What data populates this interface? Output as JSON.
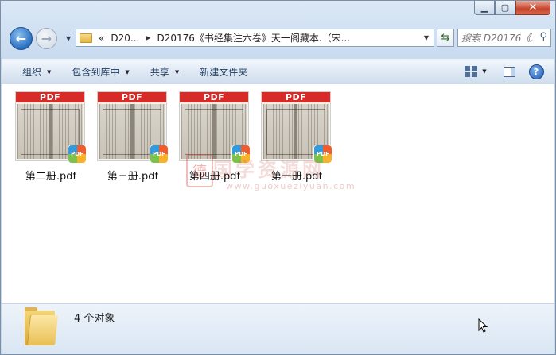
{
  "window": {
    "caption_buttons": [
      "minimize",
      "maximize",
      "close"
    ]
  },
  "navigation": {
    "back_icon": "back-arrow-icon",
    "forward_icon": "forward-arrow-icon",
    "breadcrumb": {
      "overflow": "«",
      "crumb1": "D20...",
      "crumb2": "D20176《书经集注六卷》天一阁藏本.（宋..."
    },
    "search_placeholder": "搜索 D20176《..."
  },
  "toolbar": {
    "organize": "组织",
    "include_in_library": "包含到库中",
    "share": "共享",
    "new_folder": "新建文件夹"
  },
  "files": [
    {
      "name": "第二册.pdf",
      "thumb_label": "PDF"
    },
    {
      "name": "第三册.pdf",
      "thumb_label": "PDF"
    },
    {
      "name": "第四册.pdf",
      "thumb_label": "PDF"
    },
    {
      "name": "第一册.pdf",
      "thumb_label": "PDF"
    }
  ],
  "watermark": {
    "seal": "德",
    "title": "国学资源网",
    "url": "www.guoxueziyuan.com"
  },
  "status": {
    "count_text": "4 个对象"
  },
  "colors": {
    "pdf_band": "#d62b26",
    "window_frame": "#c6d9ee"
  }
}
